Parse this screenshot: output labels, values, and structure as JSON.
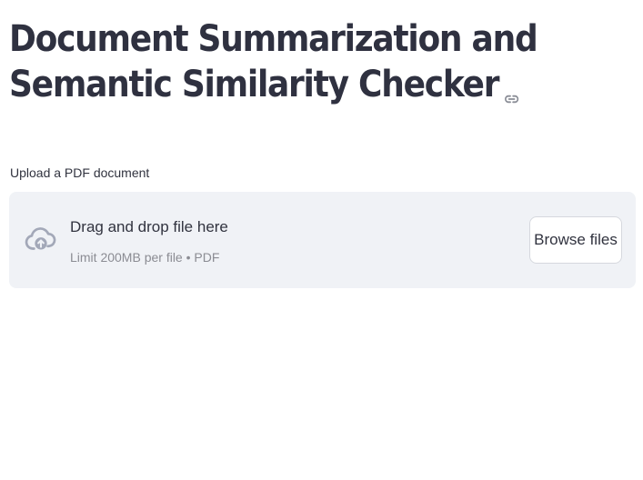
{
  "header": {
    "title_line1": "Document Summarization and",
    "title_line2": "Semantic Similarity Checker",
    "anchor_icon": "link-icon"
  },
  "uploader": {
    "label": "Upload a PDF document",
    "dropzone_text": "Drag and drop file here",
    "limit_text": "Limit 200MB per file • PDF",
    "browse_label": "Browse files",
    "upload_icon": "cloud-upload-icon"
  },
  "colors": {
    "text": "#31333f",
    "dropzone_bg": "#f0f2f6",
    "muted_text": "#8b8c93",
    "icon": "#a3a8b8"
  }
}
